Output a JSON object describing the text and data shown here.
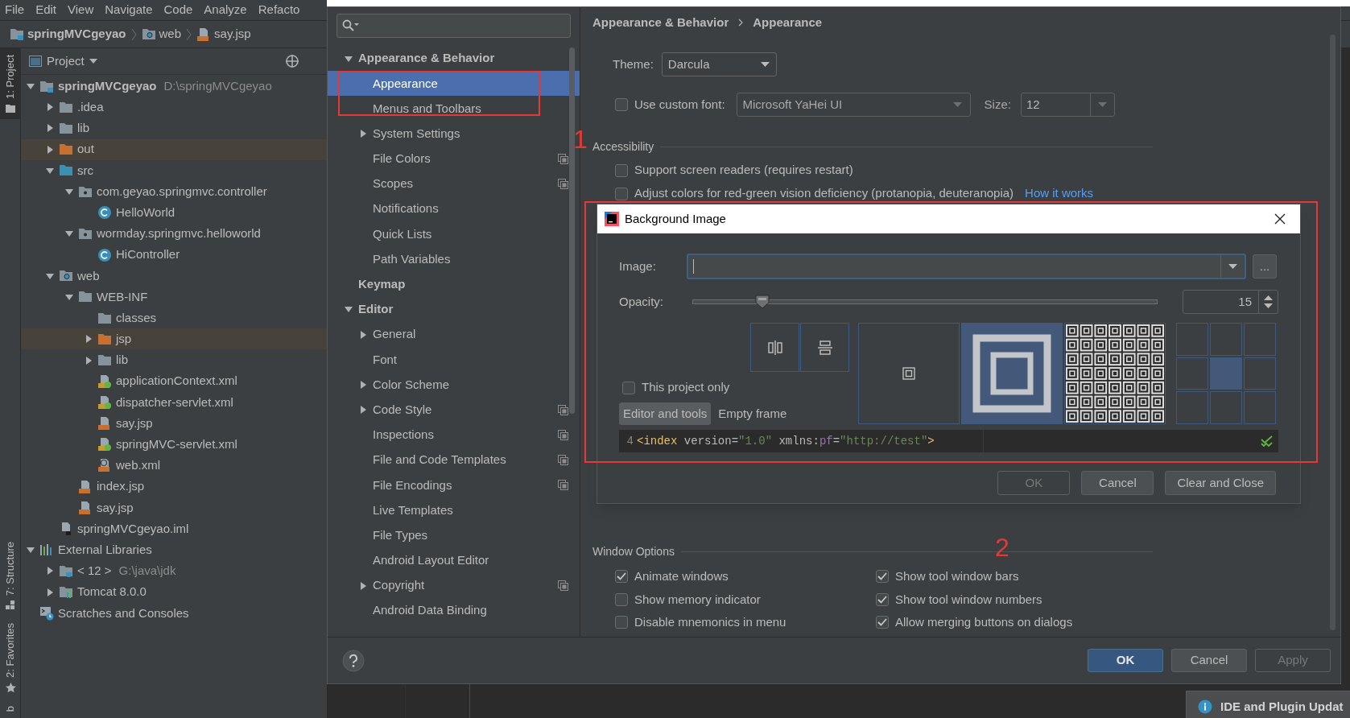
{
  "menu_bar": [
    "File",
    "Edit",
    "View",
    "Navigate",
    "Code",
    "Analyze",
    "Refacto"
  ],
  "breadcrumbs": [
    {
      "label": "springMVCgeyao",
      "kind": "project"
    },
    {
      "label": "web",
      "kind": "folder-web"
    },
    {
      "label": "say.jsp",
      "kind": "jsp"
    }
  ],
  "tool_stripe_top": [
    {
      "label": "1: Project",
      "kind": "folder",
      "selected": true
    }
  ],
  "tool_stripe_bottom": [
    {
      "label": "7: Structure",
      "kind": "structure",
      "selected": false
    },
    {
      "label": "2: Favorites",
      "kind": "star",
      "selected": false
    },
    {
      "label": "b",
      "kind": "plain",
      "selected": false
    }
  ],
  "project_panel": {
    "title": "Project",
    "tree": [
      {
        "label": "springMVCgeyao",
        "hint": "D:\\springMVCgeyao",
        "kind": "project",
        "expanded": true,
        "children": [
          {
            "label": ".idea",
            "kind": "folder",
            "expanded": false
          },
          {
            "label": "lib",
            "kind": "folder",
            "expanded": false
          },
          {
            "label": "out",
            "kind": "folder-excluded",
            "expanded": false
          },
          {
            "label": "src",
            "kind": "folder-source",
            "expanded": true,
            "children": [
              {
                "label": "com.geyao.springmvc.controller",
                "kind": "package",
                "expanded": true,
                "children": [
                  {
                    "label": "HelloWorld",
                    "kind": "class"
                  }
                ]
              },
              {
                "label": "wormday.springmvc.helloworld",
                "kind": "package",
                "expanded": true,
                "children": [
                  {
                    "label": "HiController",
                    "kind": "class"
                  }
                ]
              }
            ]
          },
          {
            "label": "web",
            "kind": "folder-web",
            "expanded": true,
            "children": [
              {
                "label": "WEB-INF",
                "kind": "folder",
                "expanded": true,
                "children": [
                  {
                    "label": "classes",
                    "kind": "folder"
                  },
                  {
                    "label": "jsp",
                    "kind": "folder-excluded",
                    "expanded": false
                  },
                  {
                    "label": "lib",
                    "kind": "folder",
                    "expanded": false
                  },
                  {
                    "label": "applicationContext.xml",
                    "kind": "xml-spring"
                  },
                  {
                    "label": "dispatcher-servlet.xml",
                    "kind": "xml-spring"
                  },
                  {
                    "label": "say.jsp",
                    "kind": "jsp"
                  },
                  {
                    "label": "springMVC-servlet.xml",
                    "kind": "xml-spring"
                  },
                  {
                    "label": "web.xml",
                    "kind": "web-xml"
                  }
                ]
              },
              {
                "label": "index.jsp",
                "kind": "jsp"
              },
              {
                "label": "say.jsp",
                "kind": "jsp"
              }
            ]
          },
          {
            "label": "springMVCgeyao.iml",
            "kind": "iml"
          }
        ]
      },
      {
        "label": "External Libraries",
        "kind": "libraries",
        "expanded": true,
        "children": [
          {
            "label": "< 12 >",
            "hint": "G:\\java\\jdk",
            "kind": "jdk",
            "expanded": false
          },
          {
            "label": "Tomcat 8.0.0",
            "kind": "tomcat",
            "expanded": false
          }
        ]
      },
      {
        "label": "Scratches and Consoles",
        "kind": "scratches"
      }
    ]
  },
  "settings": {
    "tree": [
      {
        "label": "Appearance & Behavior",
        "kind": "group",
        "expanded": true,
        "selected": false,
        "children": [
          {
            "label": "Appearance",
            "selected": true,
            "project_level": false
          },
          {
            "label": "Menus and Toolbars",
            "selected": false,
            "project_level": false
          },
          {
            "label": "System Settings",
            "expanded": false,
            "selected": false,
            "project_level": false
          },
          {
            "label": "File Colors",
            "selected": false,
            "project_level": true
          },
          {
            "label": "Scopes",
            "selected": false,
            "project_level": true
          },
          {
            "label": "Notifications",
            "selected": false,
            "project_level": false
          },
          {
            "label": "Quick Lists",
            "selected": false,
            "project_level": false
          },
          {
            "label": "Path Variables",
            "selected": false,
            "project_level": false
          }
        ]
      },
      {
        "label": "Keymap",
        "kind": "group",
        "selected": false
      },
      {
        "label": "Editor",
        "kind": "group",
        "expanded": true,
        "selected": false,
        "children": [
          {
            "label": "General",
            "expanded": false,
            "selected": false,
            "project_level": false
          },
          {
            "label": "Font",
            "selected": false,
            "project_level": false
          },
          {
            "label": "Color Scheme",
            "expanded": false,
            "selected": false,
            "project_level": false
          },
          {
            "label": "Code Style",
            "expanded": false,
            "selected": false,
            "project_level": true
          },
          {
            "label": "Inspections",
            "selected": false,
            "project_level": true
          },
          {
            "label": "File and Code Templates",
            "selected": false,
            "project_level": true
          },
          {
            "label": "File Encodings",
            "selected": false,
            "project_level": true
          },
          {
            "label": "Live Templates",
            "selected": false,
            "project_level": false
          },
          {
            "label": "File Types",
            "selected": false,
            "project_level": false
          },
          {
            "label": "Android Layout Editor",
            "selected": false,
            "project_level": false
          },
          {
            "label": "Copyright",
            "expanded": false,
            "selected": false,
            "project_level": true
          },
          {
            "label": "Android Data Binding",
            "selected": false,
            "project_level": false
          }
        ]
      }
    ],
    "breadcrumb": [
      "Appearance & Behavior",
      "Appearance"
    ],
    "theme": {
      "label": "Theme:",
      "value": "Darcula"
    },
    "custom_font": {
      "label": "Use custom font:",
      "checked": false,
      "font": "Microsoft YaHei UI",
      "size_label": "Size:",
      "size": "12"
    },
    "accessibility": {
      "title": "Accessibility",
      "options": [
        {
          "label": "Support screen readers (requires restart)",
          "checked": false
        },
        {
          "label": "Adjust colors for red-green vision deficiency (protanopia, deuteranopia)",
          "checked": false,
          "link": "How it works"
        }
      ]
    },
    "window_options": {
      "title": "Window Options",
      "columns": [
        [
          {
            "label": "Animate windows",
            "checked": true
          },
          {
            "label": "Show memory indicator",
            "checked": false
          },
          {
            "label": "Disable mnemonics in menu",
            "checked": false
          }
        ],
        [
          {
            "label": "Show tool window bars",
            "checked": true
          },
          {
            "label": "Show tool window numbers",
            "checked": true
          },
          {
            "label": "Allow merging buttons on dialogs",
            "checked": true
          }
        ]
      ]
    },
    "buttons": [
      {
        "label": "OK",
        "kind": "primary"
      },
      {
        "label": "Cancel",
        "kind": "normal"
      },
      {
        "label": "Apply",
        "kind": "disabled"
      }
    ]
  },
  "background_dialog": {
    "title": "Background Image",
    "image_label": "Image:",
    "browse": "...",
    "opacity_label": "Opacity:",
    "opacity": {
      "level": 0.15,
      "reading": "15"
    },
    "flip_buttons": [
      {
        "kind": "flip-horizontal"
      },
      {
        "kind": "flip-vertical"
      }
    ],
    "this_project_only": {
      "label": "This project only",
      "checked": false
    },
    "targets": [
      {
        "label": "Editor and tools",
        "selected": true
      },
      {
        "label": "Empty frame",
        "selected": false
      }
    ],
    "fill_modes": [
      {
        "kind": "plain",
        "selected": false
      },
      {
        "kind": "scale",
        "selected": true
      },
      {
        "kind": "tile",
        "selected": false
      }
    ],
    "anchor_cells": [
      {
        "selected": false
      },
      {
        "selected": false
      },
      {
        "selected": false
      },
      {
        "selected": false
      },
      {
        "selected": true
      },
      {
        "selected": false
      },
      {
        "selected": false
      },
      {
        "selected": false
      },
      {
        "selected": false
      }
    ],
    "preview": {
      "line_number": "4",
      "tokens": [
        {
          "text": "<index",
          "kind": "tag"
        },
        {
          "text": " version=",
          "kind": "attribute"
        },
        {
          "text": "\"1.0\"",
          "kind": "string"
        },
        {
          "text": " xmlns:",
          "kind": "attribute"
        },
        {
          "text": "pf",
          "kind": "namespace"
        },
        {
          "text": "=",
          "kind": "attribute"
        },
        {
          "text": "\"http://test\"",
          "kind": "string"
        },
        {
          "text": ">",
          "kind": "tag"
        }
      ]
    },
    "buttons": [
      {
        "label": "OK",
        "kind": "disabled"
      },
      {
        "label": "Cancel",
        "kind": "normal"
      },
      {
        "label": "Clear and Close",
        "kind": "normal"
      }
    ]
  },
  "annotations": [
    {
      "label": "1"
    },
    {
      "label": "2"
    }
  ],
  "notification": {
    "text": "IDE and Plugin Updat"
  }
}
